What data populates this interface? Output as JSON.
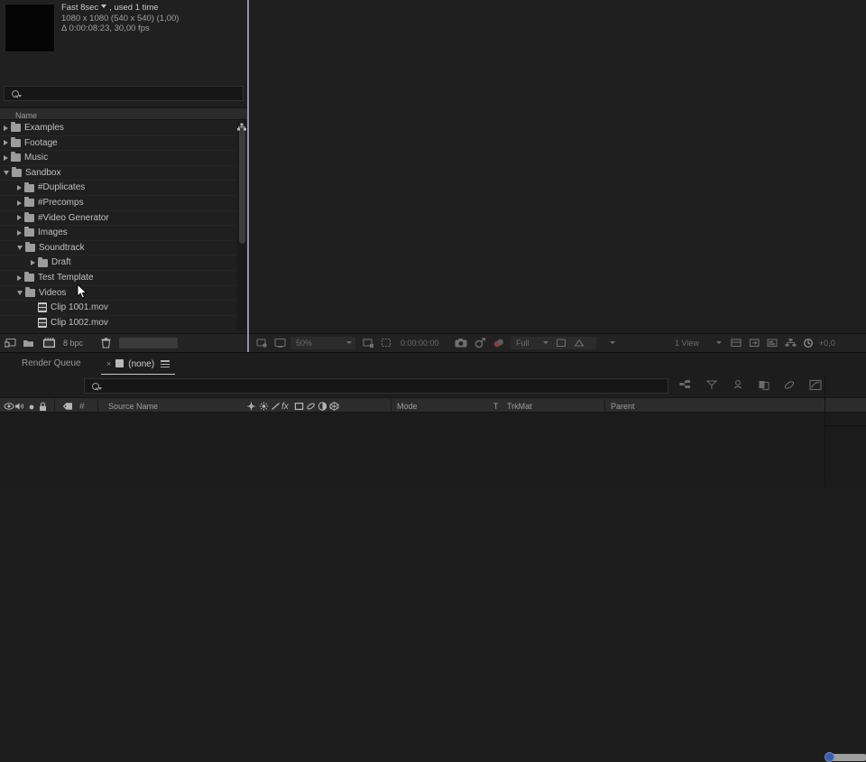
{
  "project": {
    "preview": {
      "name": "Fast 8sec",
      "usage": ", used 1 time",
      "resolution": "1080 x 1080  (540 x 540) (1,00)",
      "duration": "Δ 0:00:08:23, 30,00 fps"
    },
    "search": {
      "placeholder": ""
    },
    "columns": {
      "name": "Name"
    },
    "items": [
      {
        "label": "Examples",
        "type": "folder",
        "state": "closed",
        "depth": 0
      },
      {
        "label": "Footage",
        "type": "folder",
        "state": "closed",
        "depth": 0
      },
      {
        "label": "Music",
        "type": "folder",
        "state": "closed",
        "depth": 0
      },
      {
        "label": "Sandbox",
        "type": "folder",
        "state": "open",
        "depth": 0
      },
      {
        "label": "#Duplicates",
        "type": "folder",
        "state": "closed",
        "depth": 1
      },
      {
        "label": "#Precomps",
        "type": "folder",
        "state": "closed",
        "depth": 1
      },
      {
        "label": "#Video Generator",
        "type": "folder",
        "state": "closed",
        "depth": 1
      },
      {
        "label": "Images",
        "type": "folder",
        "state": "closed",
        "depth": 1
      },
      {
        "label": "Soundtrack",
        "type": "folder",
        "state": "open",
        "depth": 1
      },
      {
        "label": "Draft",
        "type": "folder",
        "state": "closed",
        "depth": 2
      },
      {
        "label": "Test Template",
        "type": "folder",
        "state": "closed",
        "depth": 1
      },
      {
        "label": "Videos",
        "type": "folder",
        "state": "open",
        "depth": 1
      },
      {
        "label": "Clip 1001.mov",
        "type": "movie",
        "state": "none",
        "depth": 2
      },
      {
        "label": "Clip 1002.mov",
        "type": "movie",
        "state": "none",
        "depth": 2
      }
    ],
    "bottom_toolbar": {
      "interpret_footage_icon": "interpret-footage-icon",
      "new_folder_icon": "new-folder-icon",
      "new_composition_icon": "new-composition-icon",
      "bit_depth": "8 bpc",
      "delete_icon": "trash-icon"
    }
  },
  "viewer_toolbar": {
    "magnification": "50%",
    "time": "0:00:00:00",
    "resolution": "Full",
    "view_count": "1 View",
    "target": "(None)",
    "exposure": "+0,0",
    "icons": [
      "always-preview-icon",
      "toggle-transparency-icon",
      "region-of-interest-icon",
      "grid-icon",
      "mask-icon",
      "snapshot-icon",
      "show-snapshot-icon",
      "channel-icon",
      "3d-renderer-icon",
      "view-layout-icon",
      "pixel-aspect-icon",
      "fast-previews-icon",
      "timeline-icon",
      "comp-flowchart-icon",
      "exposure-icon"
    ]
  },
  "tabs": {
    "render_queue": "Render Queue",
    "active": "(none)",
    "close_label": "×",
    "menu_icon": "panel-menu-icon"
  },
  "timeline": {
    "search": {
      "placeholder": ""
    },
    "tools": [
      "composition-mini-flowchart-icon",
      "draft-3d-icon",
      "hide-shy-layers-icon",
      "frame-blending-icon",
      "motion-blur-icon",
      "graph-editor-icon"
    ],
    "columns": {
      "video_icon": "eye-icon",
      "audio_icon": "speaker-icon",
      "solo_icon": "solo-icon",
      "lock_icon": "lock-icon",
      "label_icon": "label-color-icon",
      "number_icon": "layer-number-icon",
      "source_name": "Source Name",
      "switches": [
        "shy-icon",
        "collapse-transformations-icon",
        "quality-icon",
        "effects-icon",
        "frame-blend-icon",
        "motion-blur-icon",
        "adjustment-layer-icon",
        "3d-layer-icon"
      ],
      "mode": "Mode",
      "t": "T",
      "trkmat": "TrkMat",
      "parent": "Parent"
    },
    "zoom_slider": {
      "value": 0
    }
  },
  "colors": {
    "panel_bg": "#1f1f1f",
    "divider_accent": "#8f92ad",
    "slider_knob": "#3a5fa8",
    "text": "#c0c0c0"
  }
}
